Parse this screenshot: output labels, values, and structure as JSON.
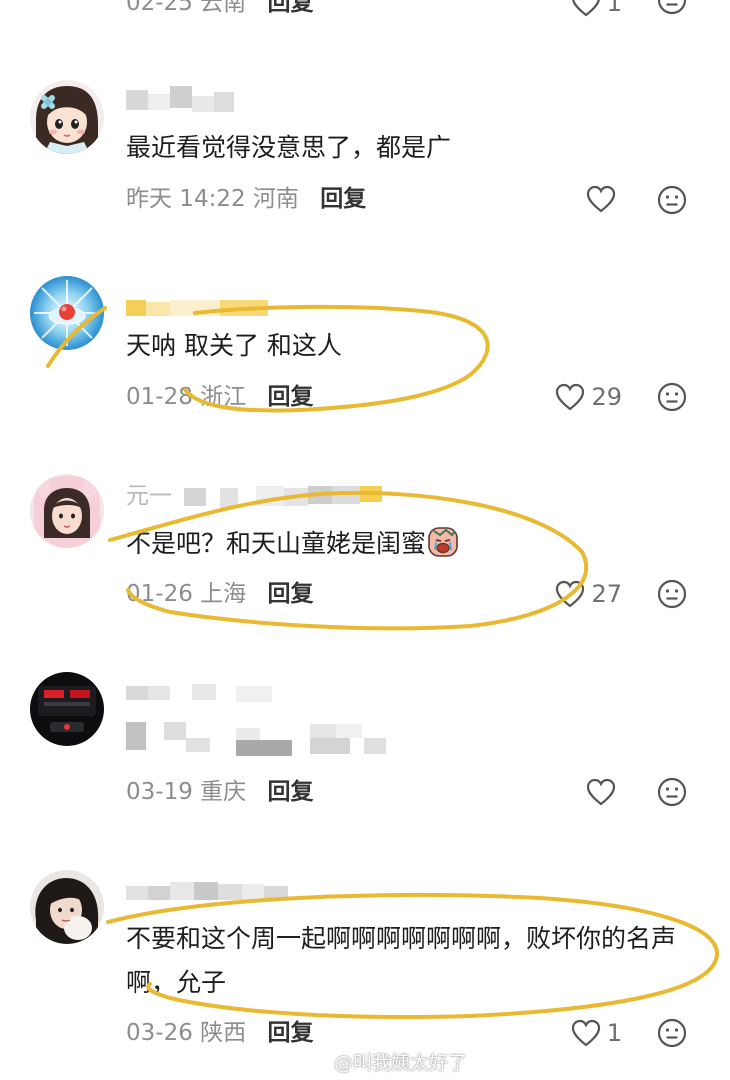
{
  "comments": [
    {
      "text": "",
      "time": "02-25",
      "location": "云南",
      "reply_label": "回复",
      "likes": "1"
    },
    {
      "text": "最近看觉得没意思了，都是广",
      "time": "昨天 14:22",
      "location": "河南",
      "reply_label": "回复",
      "likes": ""
    },
    {
      "text": "天呐 取关了 和这人",
      "time": "01-28",
      "location": "浙江",
      "reply_label": "回复",
      "likes": "29"
    },
    {
      "username_partial": "元一",
      "text": "不是吧？和天山童姥是闺蜜",
      "emoji": "crying-face-emoji",
      "time": "01-26",
      "location": "上海",
      "reply_label": "回复",
      "likes": "27"
    },
    {
      "text": "",
      "time": "03-19",
      "location": "重庆",
      "reply_label": "回复",
      "likes": ""
    },
    {
      "text": "不要和这个周一起啊啊啊啊啊啊啊，败坏你的名声啊，允子",
      "time": "03-26",
      "location": "陕西",
      "reply_label": "回复",
      "likes": "1"
    }
  ],
  "watermark": "@叫我姨太好了",
  "colors": {
    "highlight": "#e8b931",
    "meta_text": "#8d8d8d",
    "body_text": "#1e1e1e"
  },
  "icons": [
    "heart-outline-icon",
    "neutral-face-icon"
  ]
}
